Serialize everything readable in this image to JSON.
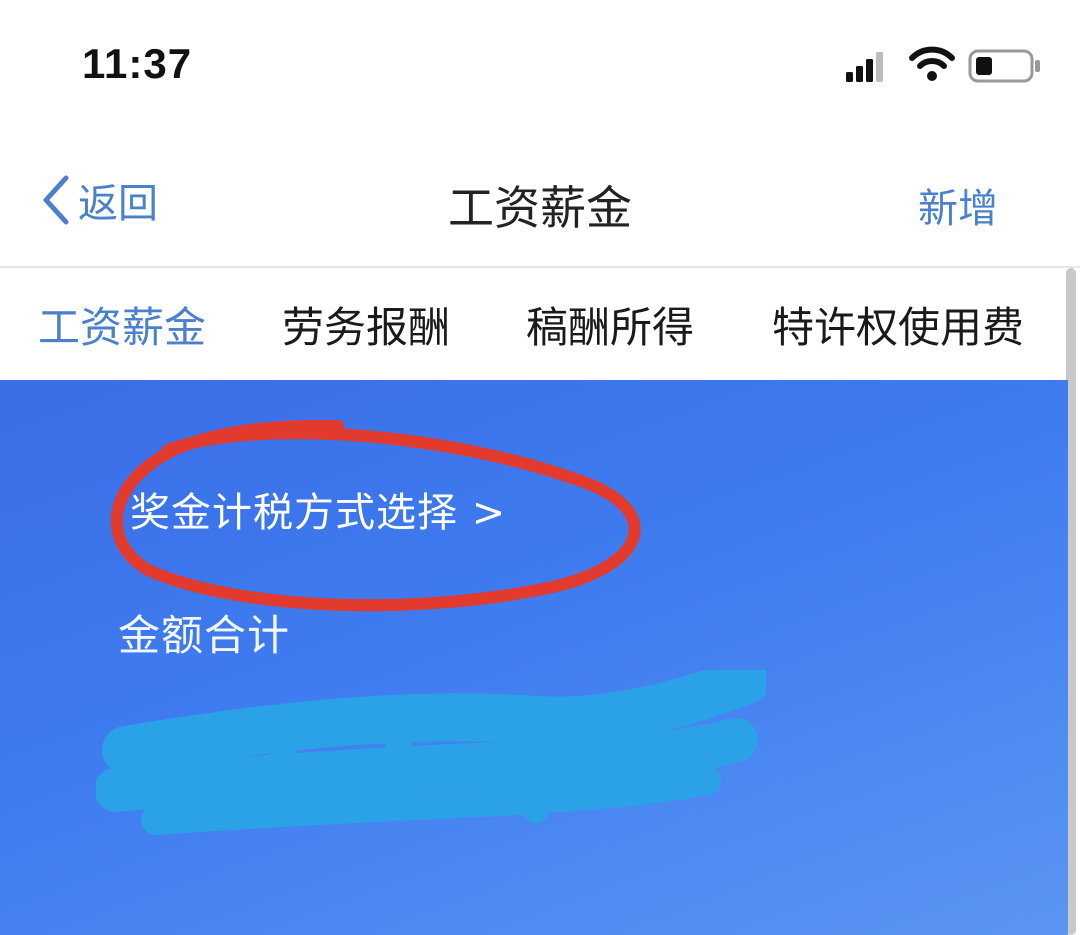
{
  "status_bar": {
    "time": "11:37"
  },
  "nav": {
    "back_label": "返回",
    "title": "工资薪金",
    "add_label": "新增"
  },
  "tabs": [
    {
      "label": "工资薪金",
      "active": true
    },
    {
      "label": "劳务报酬",
      "active": false
    },
    {
      "label": "稿酬所得",
      "active": false
    },
    {
      "label": "特许权使用费",
      "active": false
    }
  ],
  "card": {
    "bonus_method_link": "奖金计税方式选择 >",
    "total_label": "金额合计"
  },
  "colors": {
    "accent": "#4a80cc",
    "card_blue": "#3f7cf0",
    "annotation_red": "#e23b2e",
    "redaction_cyan": "#2aa4e8"
  },
  "icons": [
    "signal-icon",
    "wifi-icon",
    "battery-icon",
    "chevron-left-icon"
  ]
}
